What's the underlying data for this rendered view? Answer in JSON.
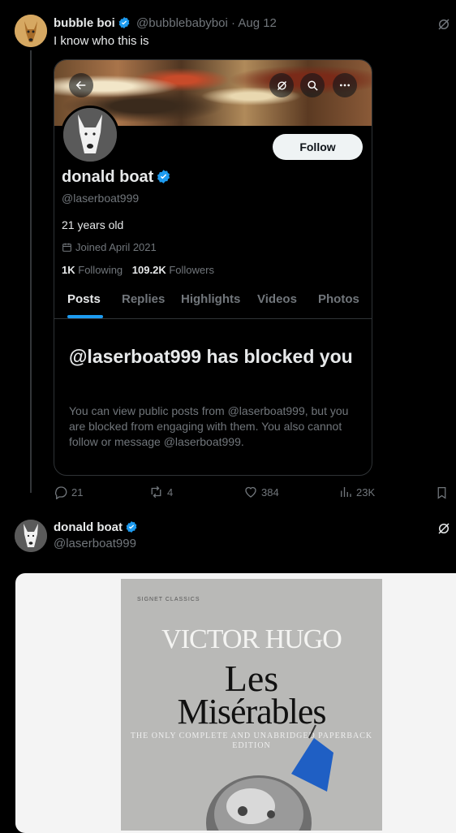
{
  "tweet1": {
    "display_name": "bubble boi",
    "handle": "@bubblebabyboi",
    "separator": "·",
    "date": "Aug 12",
    "text": "I know who this is",
    "actions": {
      "replies": "21",
      "reposts": "4",
      "likes": "384",
      "views": "23K"
    }
  },
  "embedded_profile": {
    "follow_label": "Follow",
    "display_name": "donald boat",
    "handle": "@laserboat999",
    "bio": "21 years old",
    "joined": "Joined April 2021",
    "following_count": "1K",
    "following_label": "Following",
    "followers_count": "109.2K",
    "followers_label": "Followers",
    "tabs": [
      "Posts",
      "Replies",
      "Highlights",
      "Videos",
      "Photos"
    ],
    "blocked_title": "@laserboat999 has blocked you",
    "blocked_body": "You can view public posts from @laserboat999, but you are blocked from engaging with them. You also cannot follow or message @laserboat999."
  },
  "tweet2": {
    "display_name": "donald boat",
    "handle": "@laserboat999"
  },
  "book": {
    "publisher": "SIGNET CLASSICS",
    "author": "VICTOR HUGO",
    "title_line1": "Les",
    "title_line2": "Misérables",
    "subtitle": "THE ONLY COMPLETE AND UNABRIDGED PAPERBACK EDITION"
  },
  "colors": {
    "verified": "#1d9bf0",
    "accent": "#1d9bf0",
    "muted": "#71767b"
  }
}
